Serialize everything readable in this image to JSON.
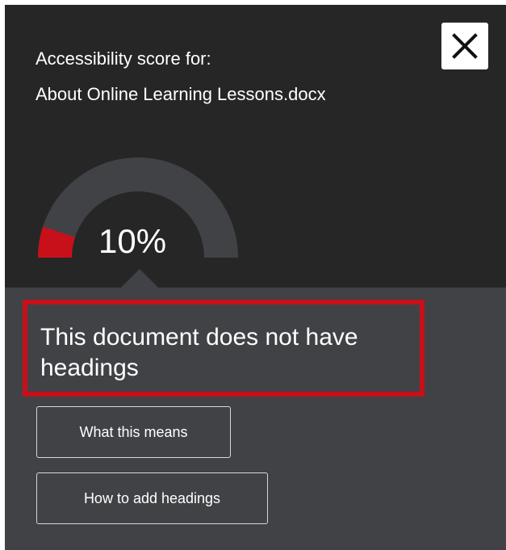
{
  "header": {
    "caption_line1": "Accessibility score for:",
    "caption_line2": "About Online Learning Lessons.docx",
    "close_icon": "close-icon"
  },
  "score": {
    "display": "10%",
    "value_percent": 10,
    "fill_color": "#c8101a",
    "track_color": "#414246"
  },
  "issue": {
    "message": "This document does not have headings",
    "highlight_color": "#c8101a"
  },
  "actions": {
    "what_this_means": "What this means",
    "how_to_add_headings": "How to add headings"
  }
}
